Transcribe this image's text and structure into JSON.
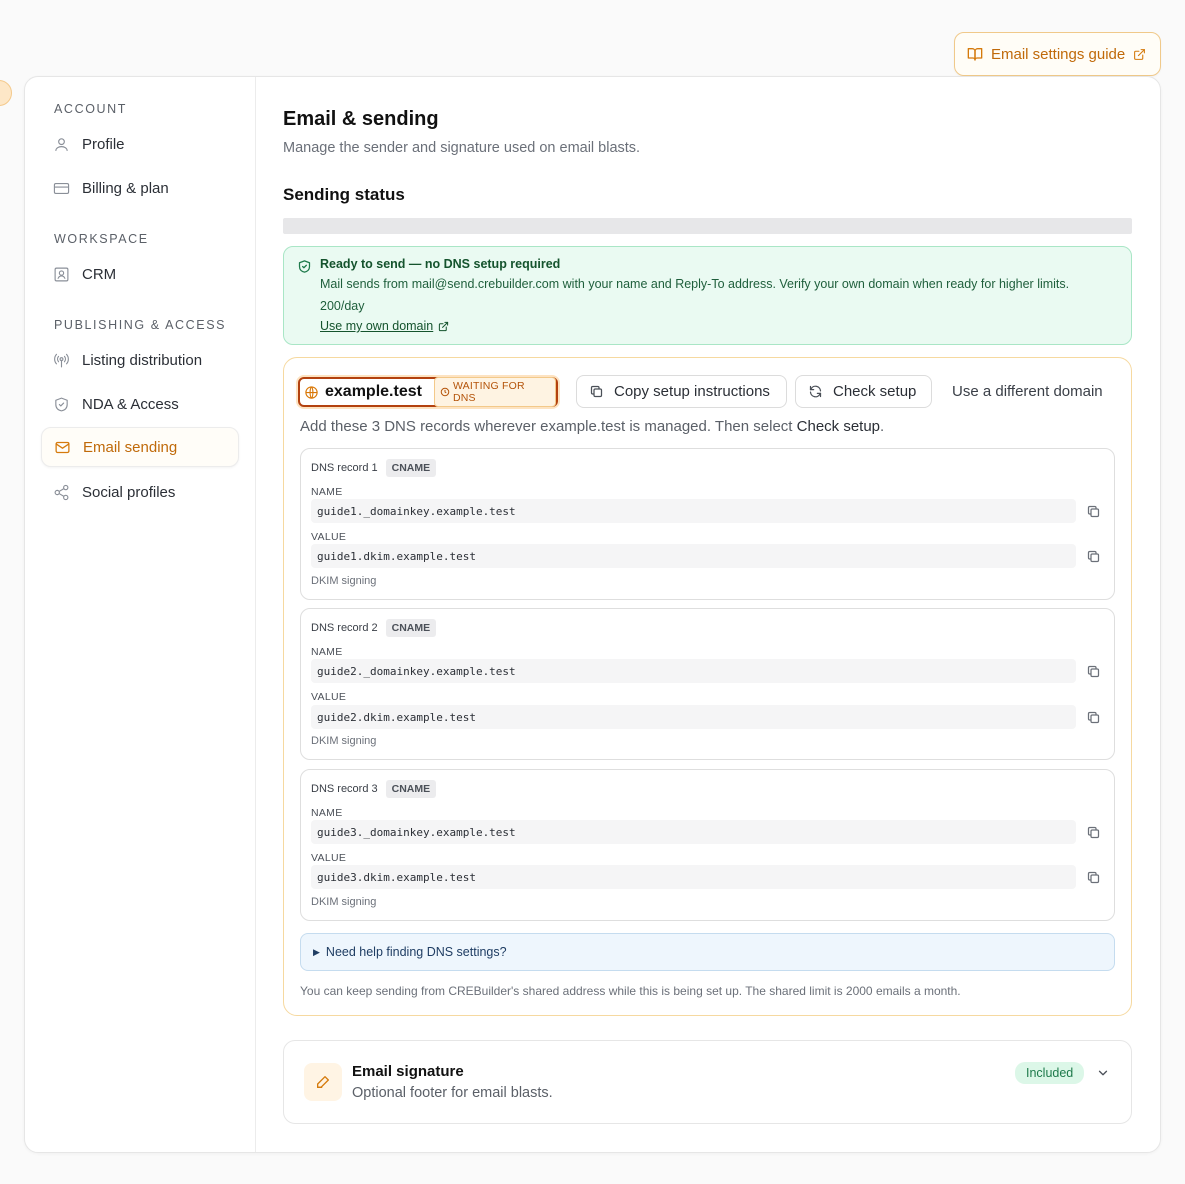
{
  "guide_button": {
    "label": "Email settings guide"
  },
  "sidebar": {
    "sections": [
      {
        "title": "ACCOUNT"
      },
      {
        "title": "WORKSPACE"
      },
      {
        "title": "PUBLISHING & ACCESS"
      }
    ],
    "items": [
      {
        "label": "Profile",
        "icon": "user-icon"
      },
      {
        "label": "Billing & plan",
        "icon": "credit-card-icon"
      },
      {
        "label": "CRM",
        "icon": "contact-card-icon"
      },
      {
        "label": "Listing distribution",
        "icon": "broadcast-icon"
      },
      {
        "label": "NDA & Access",
        "icon": "shield-icon"
      },
      {
        "label": "Email sending",
        "icon": "mail-icon",
        "active": true
      },
      {
        "label": "Social profiles",
        "icon": "share-icon"
      }
    ]
  },
  "main": {
    "title": "Email & sending",
    "subtitle": "Manage the sender and signature used on email blasts.",
    "sending_status_title": "Sending status",
    "ready": {
      "title": "Ready to send — no DNS setup required",
      "description": "Mail sends from mail@send.crebuilder.com with your name and Reply-To address. Verify your own domain when ready for higher limits.",
      "limit": "200/day",
      "link": "Use my own domain"
    },
    "domain": {
      "name": "example.test",
      "status": "WAITING FOR DNS",
      "copy_button": "Copy setup instructions",
      "check_button": "Check setup",
      "different_button": "Use a different domain",
      "instructions_prefix": "Add these 3 DNS records wherever example.test is managed. Then select ",
      "instructions_strong": "Check setup",
      "instructions_suffix": ".",
      "records": [
        {
          "title": "DNS record 1",
          "type": "CNAME",
          "name_label": "NAME",
          "name": "guide1._domainkey.example.test",
          "value_label": "VALUE",
          "value": "guide1.dkim.example.test",
          "note": "DKIM signing"
        },
        {
          "title": "DNS record 2",
          "type": "CNAME",
          "name_label": "NAME",
          "name": "guide2._domainkey.example.test",
          "value_label": "VALUE",
          "value": "guide2.dkim.example.test",
          "note": "DKIM signing"
        },
        {
          "title": "DNS record 3",
          "type": "CNAME",
          "name_label": "NAME",
          "name": "guide3._domainkey.example.test",
          "value_label": "VALUE",
          "value": "guide3.dkim.example.test",
          "note": "DKIM signing"
        }
      ],
      "help": "Need help finding DNS settings?",
      "shared_note": "You can keep sending from CREBuilder's shared address while this is being set up. The shared limit is 2000 emails a month."
    },
    "signature": {
      "title": "Email signature",
      "subtitle": "Optional footer for email blasts.",
      "badge": "Included"
    }
  },
  "colors": {
    "accent": "#d57a0c",
    "success_bg": "#eafaf2",
    "success_text": "#14532d"
  }
}
